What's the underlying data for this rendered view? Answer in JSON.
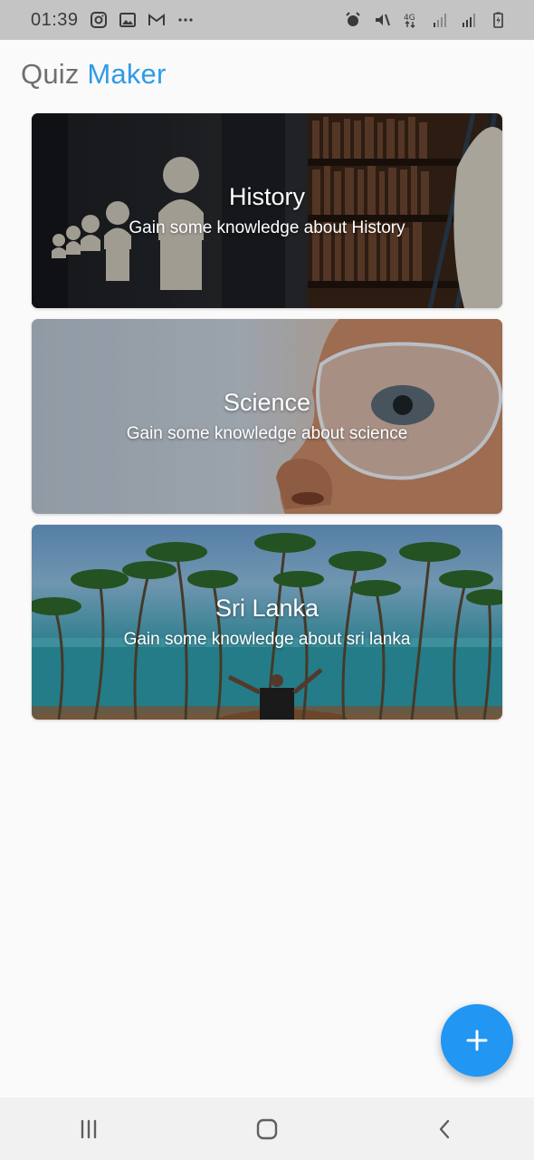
{
  "status_bar": {
    "time": "01:39",
    "left_icons": [
      "instagram-icon",
      "gallery-icon",
      "gmail-icon",
      "more-icon"
    ],
    "right_icons": [
      "alarm-icon",
      "mute-icon",
      "network-4g-icon",
      "signal-icon",
      "signal-icon",
      "battery-icon"
    ]
  },
  "header": {
    "title_part1": "Quiz",
    "title_part2": "Maker",
    "accent_color": "#2f9be8"
  },
  "quizzes": [
    {
      "title": "History",
      "subtitle": "Gain some knowledge about History"
    },
    {
      "title": "Science",
      "subtitle": "Gain some knowledge about science"
    },
    {
      "title": "Sri Lanka",
      "subtitle": "Gain some knowledge about sri lanka"
    }
  ],
  "fab": {
    "icon": "plus-icon",
    "color": "#2196f3"
  },
  "nav_bar": {
    "buttons": [
      "recent-apps-icon",
      "home-icon",
      "back-icon"
    ]
  }
}
